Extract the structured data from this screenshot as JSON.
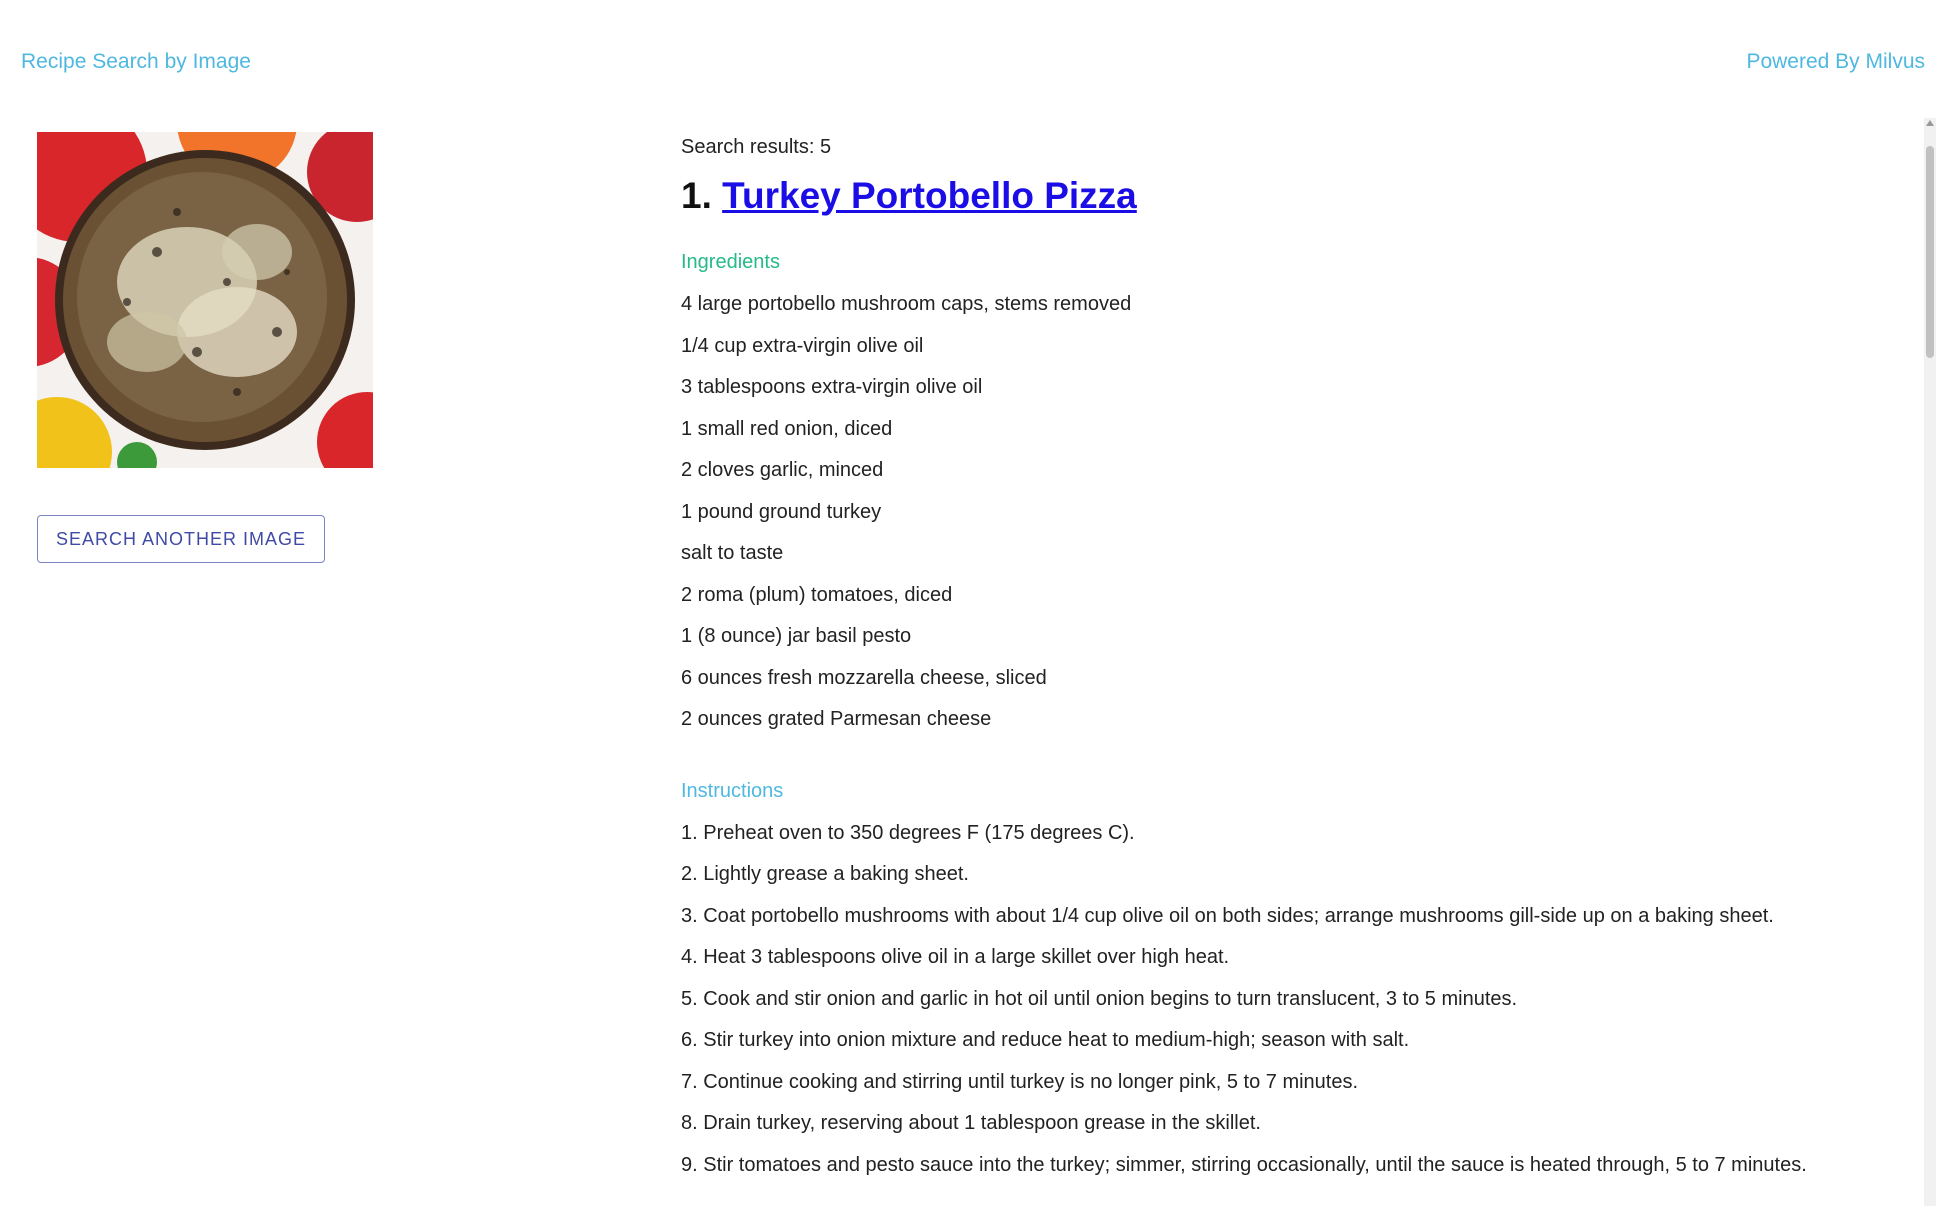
{
  "header": {
    "title": "Recipe Search by Image",
    "powered_by": "Powered By Milvus"
  },
  "left": {
    "image_alt": "Turkey portobello pizza",
    "search_button_label": "SEARCH ANOTHER IMAGE"
  },
  "results": {
    "count_text": "Search results: 5",
    "recipe": {
      "number": "1.",
      "title": "Turkey Portobello Pizza",
      "ingredients_heading": "Ingredients",
      "ingredients": [
        "4 large portobello mushroom caps, stems removed",
        "1/4 cup extra-virgin olive oil",
        "3 tablespoons extra-virgin olive oil",
        "1 small red onion, diced",
        "2 cloves garlic, minced",
        "1 pound ground turkey",
        "salt to taste",
        "2 roma (plum) tomatoes, diced",
        "1 (8 ounce) jar basil pesto",
        "6 ounces fresh mozzarella cheese, sliced",
        "2 ounces grated Parmesan cheese"
      ],
      "instructions_heading": "Instructions",
      "instructions": [
        "1. Preheat oven to 350 degrees F (175 degrees C).",
        "2. Lightly grease a baking sheet.",
        "3. Coat portobello mushrooms with about 1/4 cup olive oil on both sides; arrange mushrooms gill-side up on a baking sheet.",
        "4. Heat 3 tablespoons olive oil in a large skillet over high heat.",
        "5. Cook and stir onion and garlic in hot oil until onion begins to turn translucent, 3 to 5 minutes.",
        "6. Stir turkey into onion mixture and reduce heat to medium-high; season with salt.",
        "7. Continue cooking and stirring until turkey is no longer pink, 5 to 7 minutes.",
        "8. Drain turkey, reserving about 1 tablespoon grease in the skillet.",
        "9. Stir tomatoes and pesto sauce into the turkey; simmer, stirring occasionally, until the sauce is heated through, 5 to 7 minutes."
      ]
    }
  },
  "colors": {
    "accent": "#4fb8e0",
    "ingredients_heading": "#26b98a",
    "link": "#1a0de6",
    "button_text": "#3f4aa6"
  }
}
